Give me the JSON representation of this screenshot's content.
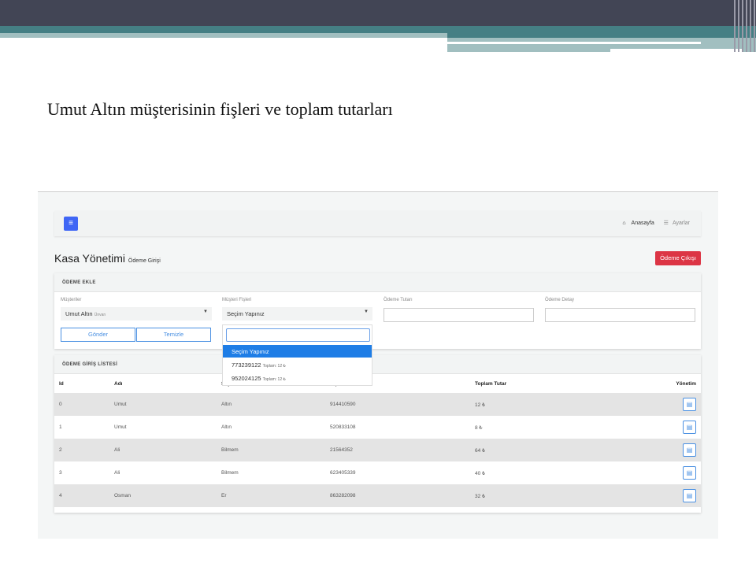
{
  "slide": {
    "title": "Umut Altın müşterisinin fişleri ve toplam tutarları"
  },
  "nav": {
    "menu_icon": "≡",
    "home": "Anasayfa",
    "settings": "Ayarlar"
  },
  "page": {
    "title": "Kasa Yönetimi",
    "subtitle": "Ödeme Girişi",
    "exit_button": "Ödeme Çıkışı"
  },
  "form": {
    "title": "ÖDEME EKLE",
    "customers_label": "Müşteriler",
    "customer_value": "Umut Altın",
    "customer_sub": "Ünvan",
    "receipts_label": "Müşteri Fişleri",
    "receipt_value": "Seçim Yapınız",
    "amount_label": "Ödeme Tutarı",
    "detail_label": "Ödeme Detay",
    "send": "Gönder",
    "clear": "Temizle"
  },
  "dropdown": {
    "items": [
      {
        "label": "Seçim Yapınız",
        "sub": ""
      },
      {
        "label": "773239122",
        "sub": "Toplam: 12 ₺"
      },
      {
        "label": "952024125",
        "sub": "Toplam: 12 ₺"
      }
    ]
  },
  "list": {
    "title": "ÖDEME GİRİŞ LİSTESİ",
    "headers": [
      "Id",
      "Adı",
      "Soyadı",
      "Fiş No",
      "Toplam Tutar",
      "Yönetim"
    ],
    "rows": [
      [
        "0",
        "Umut",
        "Altın",
        "914410590",
        "12 ₺"
      ],
      [
        "1",
        "Umut",
        "Altın",
        "520833108",
        "8 ₺"
      ],
      [
        "2",
        "Ali",
        "Bilmem",
        "21564352",
        "64 ₺"
      ],
      [
        "3",
        "Ali",
        "Bilmem",
        "623405339",
        "40 ₺"
      ],
      [
        "4",
        "Osman",
        "Er",
        "863282098",
        "32 ₺"
      ]
    ]
  },
  "colors": {
    "accent": "#3f66f5",
    "danger": "#dc3545",
    "header_dark": "#424555",
    "teal": "#457f84"
  }
}
